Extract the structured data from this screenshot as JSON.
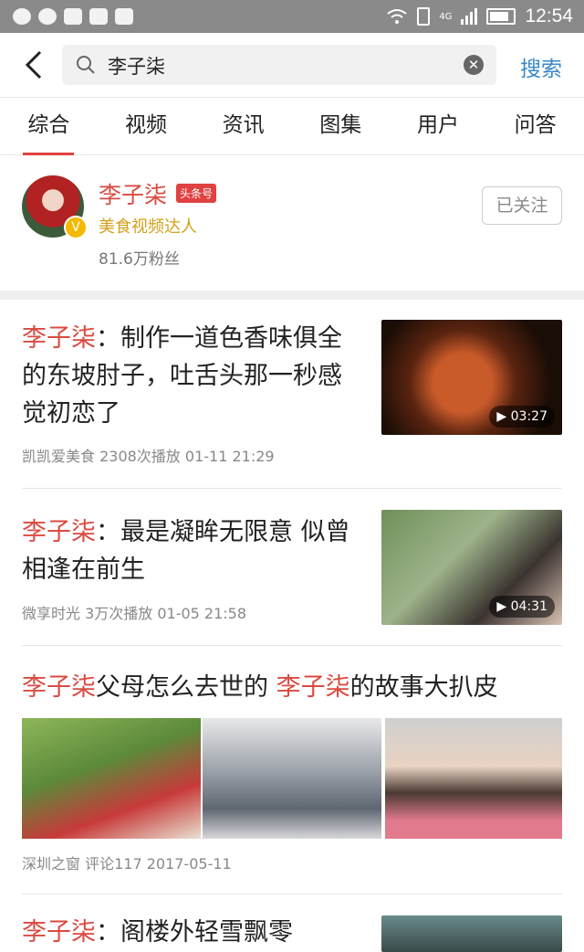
{
  "status": {
    "time": "12:54",
    "network": "4G"
  },
  "search": {
    "query": "李子柒",
    "button_label": "搜索"
  },
  "tabs": [
    {
      "label": "综合",
      "active": true
    },
    {
      "label": "视频"
    },
    {
      "label": "资讯"
    },
    {
      "label": "图集"
    },
    {
      "label": "用户"
    },
    {
      "label": "问答"
    }
  ],
  "profile": {
    "name": "李子柒",
    "tag": "头条号",
    "description": "美食视频达人",
    "fans": "81.6万粉丝",
    "follow_label": "已关注"
  },
  "results": [
    {
      "title_highlight": "李子柒",
      "title_rest": "：制作一道色香味俱全的东坡肘子，吐舌头那一秒感觉初恋了",
      "meta": "凯凯爱美食  2308次播放  01-11 21:29",
      "duration": "03:27"
    },
    {
      "title_highlight": "李子柒",
      "title_rest": "：最是凝眸无限意 似曾相逢在前生",
      "meta": "微享时光  3万次播放  01-05 21:58",
      "duration": "04:31"
    },
    {
      "title_part1": "李子柒",
      "title_part2": "父母怎么去世的 ",
      "title_part3": "李子柒",
      "title_part4": "的故事大扒皮",
      "meta": "深圳之窗  评论117  2017-05-11"
    },
    {
      "title_highlight": "李子柒",
      "title_rest": "：阁楼外轻雪飘零"
    }
  ]
}
